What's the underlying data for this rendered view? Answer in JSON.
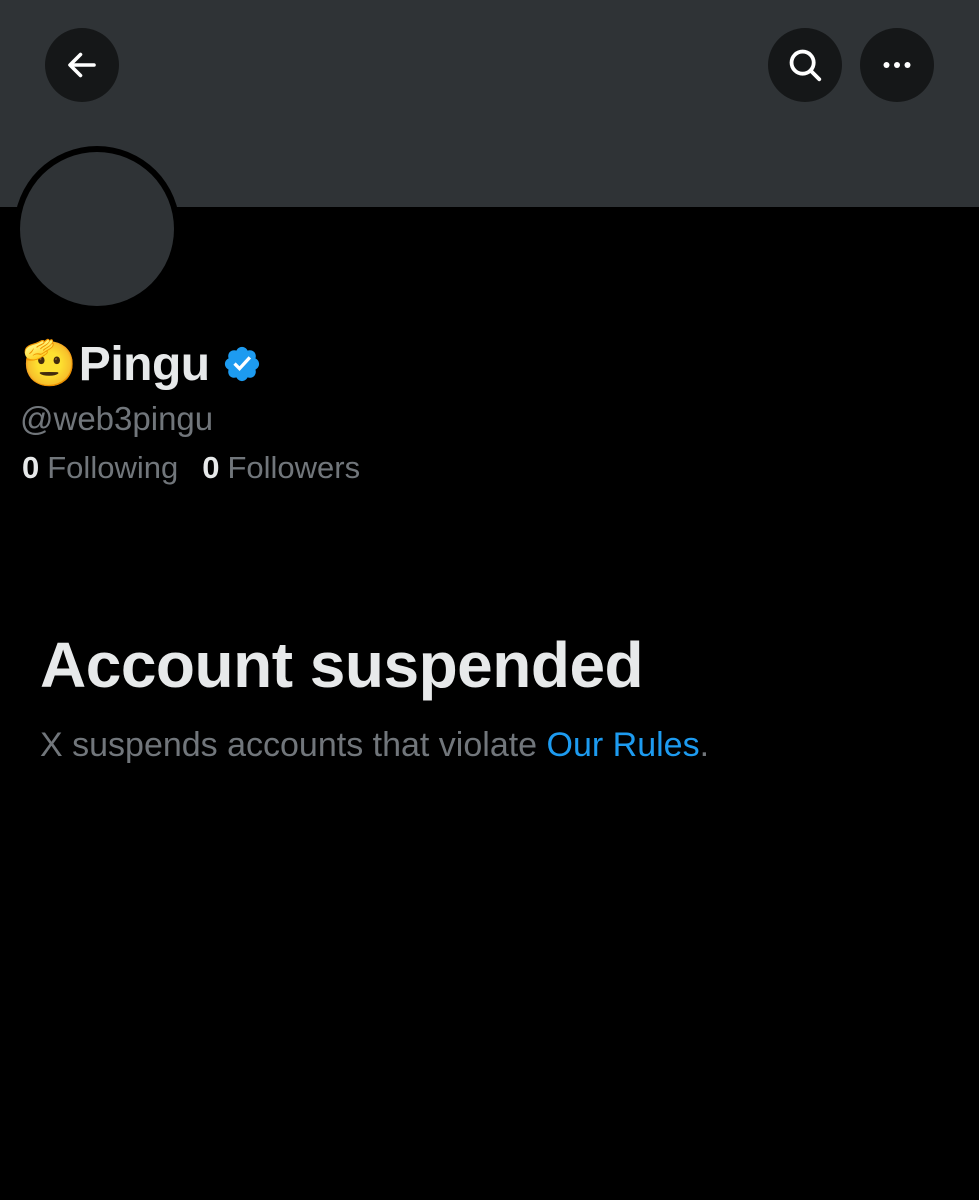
{
  "header": {
    "back_icon": "arrow-left-icon",
    "search_icon": "search-icon",
    "more_icon": "more-horizontal-icon"
  },
  "profile": {
    "emoji": "🫡",
    "name": "Pingu",
    "verified_icon": "verified-badge-icon",
    "handle": "@web3pingu",
    "following_count": "0",
    "following_label": "Following",
    "followers_count": "0",
    "followers_label": "Followers"
  },
  "suspension": {
    "title": "Account suspended",
    "message_prefix": "X suspends accounts that violate ",
    "rules_link": "Our Rules",
    "message_suffix": "."
  },
  "colors": {
    "background": "#000000",
    "banner": "#2f3336",
    "button_bg": "#151718",
    "primary_text": "#e7e9ea",
    "secondary_text": "#71767b",
    "accent": "#1d9bf0"
  }
}
